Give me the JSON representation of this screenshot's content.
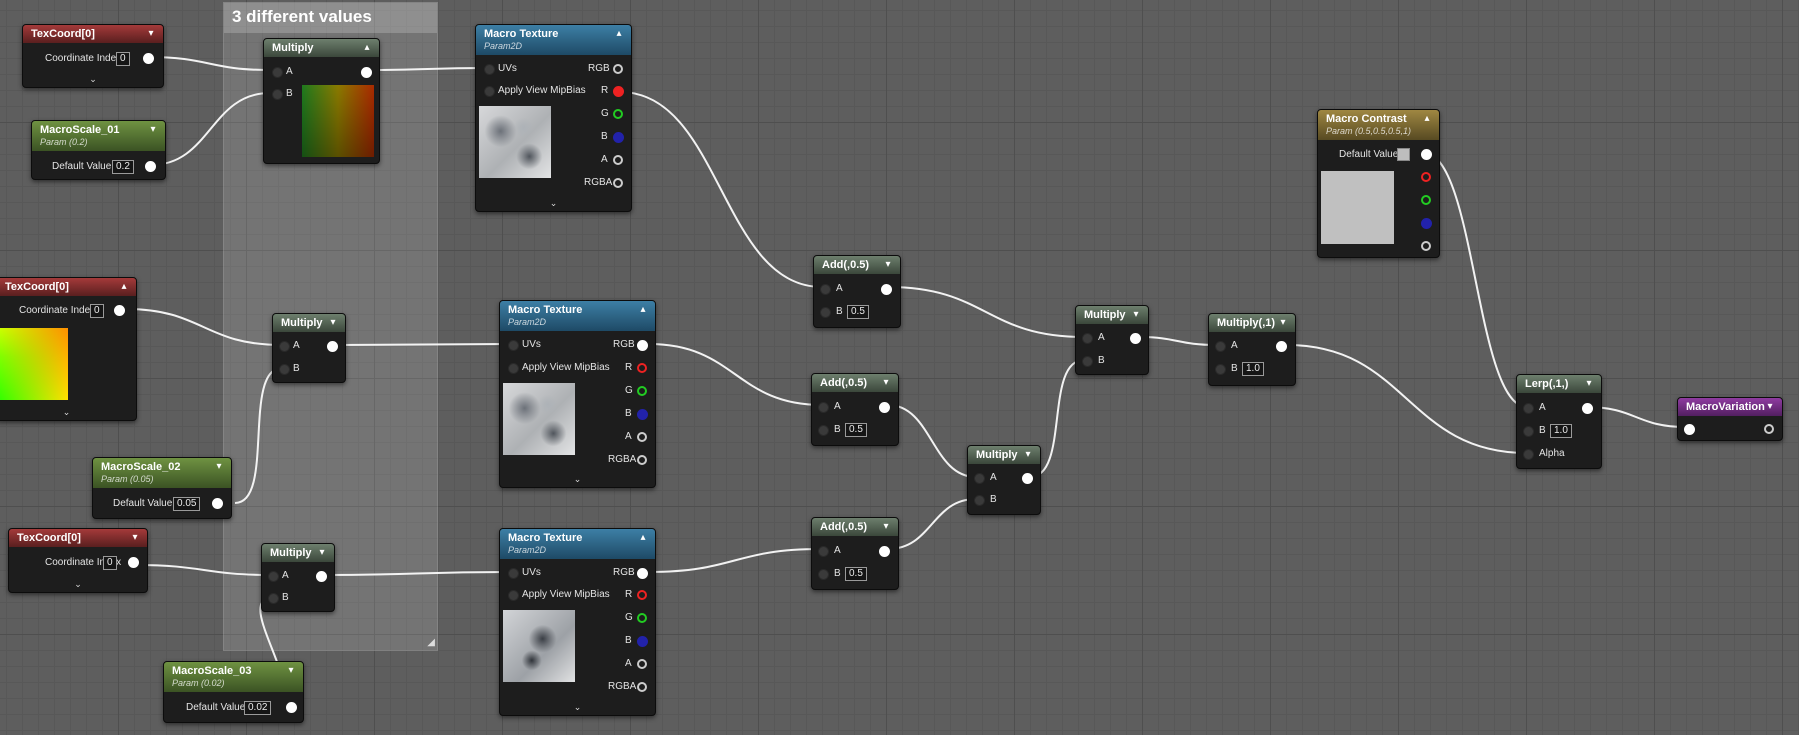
{
  "comment": {
    "title": "3 different values"
  },
  "labels": {
    "a": "A",
    "b": "B",
    "alpha": "Alpha",
    "uvs": "UVs",
    "apply_mip": "Apply View MipBias",
    "rgb": "RGB",
    "r": "R",
    "g": "G",
    "bl": "B",
    "al": "A",
    "rgba": "RGBA",
    "coord_index": "Coordinate Index",
    "default_value": "Default Value"
  },
  "nodes": {
    "texcoord1": {
      "title": "TexCoord[0]",
      "coord_value": "0"
    },
    "texcoord2": {
      "title": "TexCoord[0]",
      "coord_value": "0"
    },
    "texcoord3": {
      "title": "TexCoord[0]",
      "coord_value": "0"
    },
    "scale1": {
      "title": "MacroScale_01",
      "subtitle": "Param (0.2)",
      "value": "0.2"
    },
    "scale2": {
      "title": "MacroScale_02",
      "subtitle": "Param (0.05)",
      "value": "0.05"
    },
    "scale3": {
      "title": "MacroScale_03",
      "subtitle": "Param (0.02)",
      "value": "0.02"
    },
    "multiply1": {
      "title": "Multiply"
    },
    "multiply2": {
      "title": "Multiply"
    },
    "multiply3": {
      "title": "Multiply"
    },
    "tex1": {
      "title": "Macro Texture",
      "subtitle": "Param2D"
    },
    "tex2": {
      "title": "Macro Texture",
      "subtitle": "Param2D"
    },
    "tex3": {
      "title": "Macro Texture",
      "subtitle": "Param2D"
    },
    "add1": {
      "title": "Add(,0.5)",
      "b_value": "0.5"
    },
    "add2": {
      "title": "Add(,0.5)",
      "b_value": "0.5"
    },
    "add3": {
      "title": "Add(,0.5)",
      "b_value": "0.5"
    },
    "multiply4": {
      "title": "Multiply"
    },
    "multiply5": {
      "title": "Multiply"
    },
    "multiply6": {
      "title": "Multiply(,1)",
      "b_value": "1.0"
    },
    "contrast": {
      "title": "Macro Contrast",
      "subtitle": "Param (0.5,0.5,0.5,1)"
    },
    "lerp": {
      "title": "Lerp(,1,)",
      "b_value": "1.0"
    },
    "variation": {
      "title": "MacroVariation"
    }
  },
  "colors": {
    "canvas": "#5e5e5e",
    "wire": "#f2f2f2",
    "texcoord": "#a43a3a",
    "scalar": "#6f9242",
    "texture": "#3d7fa5",
    "vector": "#9f8742",
    "output": "#8f3ba1"
  }
}
